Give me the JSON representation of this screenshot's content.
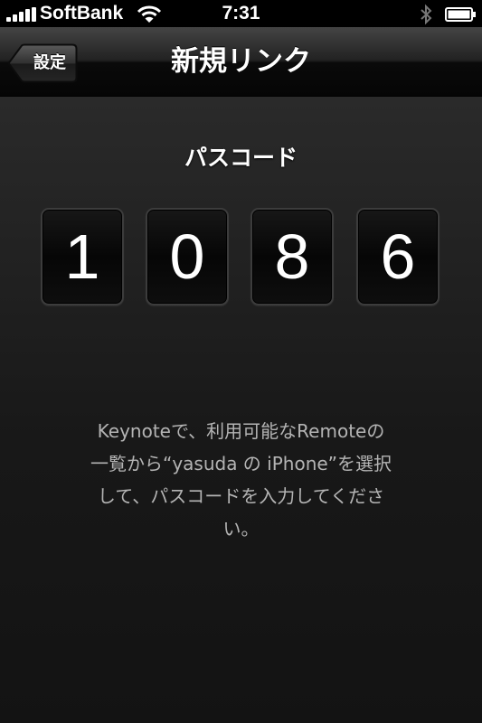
{
  "status_bar": {
    "carrier": "SoftBank",
    "time": "7:31",
    "icons": [
      "signal-bars-icon",
      "wifi-icon",
      "bluetooth-icon",
      "battery-icon"
    ]
  },
  "nav": {
    "back_label": "設定",
    "title": "新規リンク"
  },
  "main": {
    "heading": "パスコード",
    "digits": [
      "1",
      "0",
      "8",
      "6"
    ],
    "instruction_lines": [
      "Keynoteで、利用可能なRemoteの",
      "一覧から“yasuda の iPhone”を選択",
      "して、パスコードを入力してくださ",
      "い。"
    ]
  },
  "colors": {
    "background": "#1d1d1d",
    "text": "#ffffff",
    "instruction_text": "#b4b4b4"
  }
}
